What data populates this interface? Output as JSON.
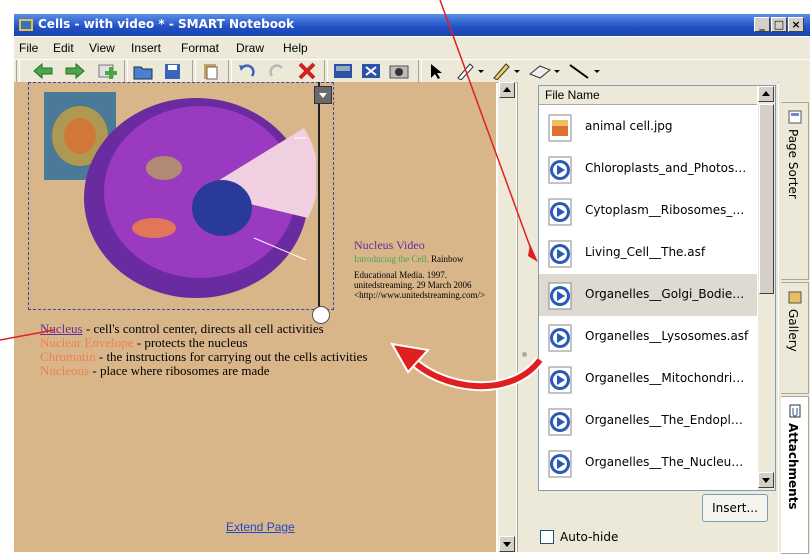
{
  "window": {
    "title": "Cells - with video * - SMART Notebook",
    "controls": [
      "_",
      "□",
      "×"
    ]
  },
  "menu": [
    "File",
    "Edit",
    "View",
    "Insert",
    "Format",
    "Draw",
    "Help"
  ],
  "toolbar": {
    "icons": [
      "previous-page",
      "next-page",
      "add-page",
      "open",
      "save",
      "paste",
      "undo",
      "redo",
      "delete",
      "screen-shade",
      "full-screen",
      "capture",
      "select",
      "pen",
      "creative-pen",
      "eraser",
      "line"
    ]
  },
  "canvas": {
    "video_caption": {
      "title": "Nucleus Video",
      "line1_colored": "Introducing the Cell.",
      "line1_rest": " Rainbow",
      "line2": "Educational Media. 1997.",
      "line3": "unitedstreaming. 29 March 2006",
      "line4": "<http://www.unitedstreaming.com/>"
    },
    "terms": [
      {
        "term": "Nucleus",
        "desc": " - cell's control center, directs all cell activities",
        "color": "#6a2a9a"
      },
      {
        "term": "Nuclear Envelope",
        "desc": " - protects the nucleus",
        "color": "#f08050"
      },
      {
        "term": "Chromatin",
        "desc": " - the instructions for carrying out the cells activities",
        "color": "#f08050"
      },
      {
        "term": "Nucleous",
        "desc": " -  place where ribosomes are made",
        "color": "#f08050"
      }
    ],
    "extend_page": "Extend Page"
  },
  "attachments": {
    "header": "File Name",
    "files": [
      {
        "name": "animal cell.jpg",
        "icon": "image-file-icon"
      },
      {
        "name": "Chloroplasts_and_Photos…",
        "icon": "media-file-icon"
      },
      {
        "name": "Cytoplasm__Ribosomes_…",
        "icon": "media-file-icon"
      },
      {
        "name": "Living_Cell__The.asf",
        "icon": "media-file-icon"
      },
      {
        "name": "Organelles__Golgi_Bodie…",
        "icon": "media-file-icon"
      },
      {
        "name": "Organelles__Lysosomes.asf",
        "icon": "media-file-icon"
      },
      {
        "name": "Organelles__Mitochondri…",
        "icon": "media-file-icon"
      },
      {
        "name": "Organelles__The_Endopl…",
        "icon": "media-file-icon"
      },
      {
        "name": "Organelles__The_Nucleu…",
        "icon": "media-file-icon"
      }
    ],
    "insert_button": "Insert...",
    "autohide_label": "Auto-hide"
  },
  "side_tabs": [
    "Page Sorter",
    "Gallery",
    "Attachments"
  ],
  "colors": {
    "accent_red": "#e02020",
    "workarea": "#d9b68a",
    "selected_row": "#dedad2"
  }
}
